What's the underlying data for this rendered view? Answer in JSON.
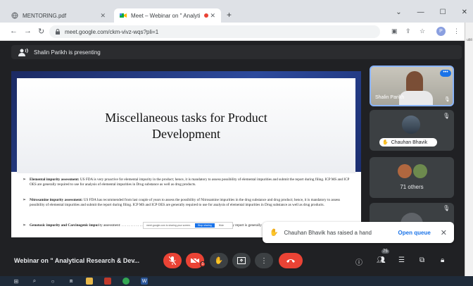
{
  "browser": {
    "tabs": [
      {
        "title": "MENTORING.pdf",
        "active": false
      },
      {
        "title": "Meet – Webinar on \" Analyti",
        "active": true
      }
    ],
    "new_tab": "+",
    "window_controls": {
      "chevron": "⌄",
      "minimize": "—",
      "maximize": "☐",
      "close": "✕"
    },
    "url": "meet.google.com/ckm-vivz-wqs?pli=1",
    "profile_initial": "P",
    "side_window_text": "ubli"
  },
  "meet": {
    "presenting_text": "Shalin Parikh is presenting",
    "slide": {
      "title_line1": "Miscellaneous tasks for Product",
      "title_line2": "Development",
      "bullets": [
        {
          "head": "Elemental impurity assessment:",
          "body": " US FDA is very proactive for elemental impurity in the product; hence, it is mandatory to assess possibility of elemental impurities and submit the report during filing. ICP MS and ICP OES are generally required to use for analysis of elemental impurities in Drug substance as well as drug products."
        },
        {
          "head": "Nitrosamine impurity assessment:",
          "body": " US FDA has recommended from last couple of years to assess the possibility of Nitrosamine impurities in the drug substance and drug product; hence, it is mandatory to assess possibility of elemental impurities and submit the report during filing. ICP MS and ICP OES are generally required to use for analysis of elemental impurities in Drug substance as well as drug products."
        },
        {
          "head": "Genotoxic impurity and Carcinogenic impu",
          "body": "rity assessment: . . . . . . . . . . . . . . . . . . . . . . generally assess impurities. The assessment study report is generally a part of submission."
        }
      ],
      "share_toast": {
        "text": "meet.google.com is sharing your screen.",
        "stop": "Stop sharing",
        "hide": "Hide"
      }
    },
    "tiles": {
      "self_name": "Shalin Parikh",
      "self_more": "•••",
      "chauhan_name": "Chauhan Bhavik",
      "others_count": "71 others"
    },
    "hand_toast": {
      "message": "Chauhan Bhavik has raised a hand",
      "action": "Open queue"
    },
    "bottom": {
      "meeting_title": "Webinar on \" Analytical Research & Dev...",
      "participants_badge": "75",
      "cam_badge": "1"
    }
  },
  "colors": {
    "accent": "#1a73e8",
    "danger": "#ea4335",
    "meet_bg": "#202124",
    "tile_bg": "#3c4043"
  }
}
